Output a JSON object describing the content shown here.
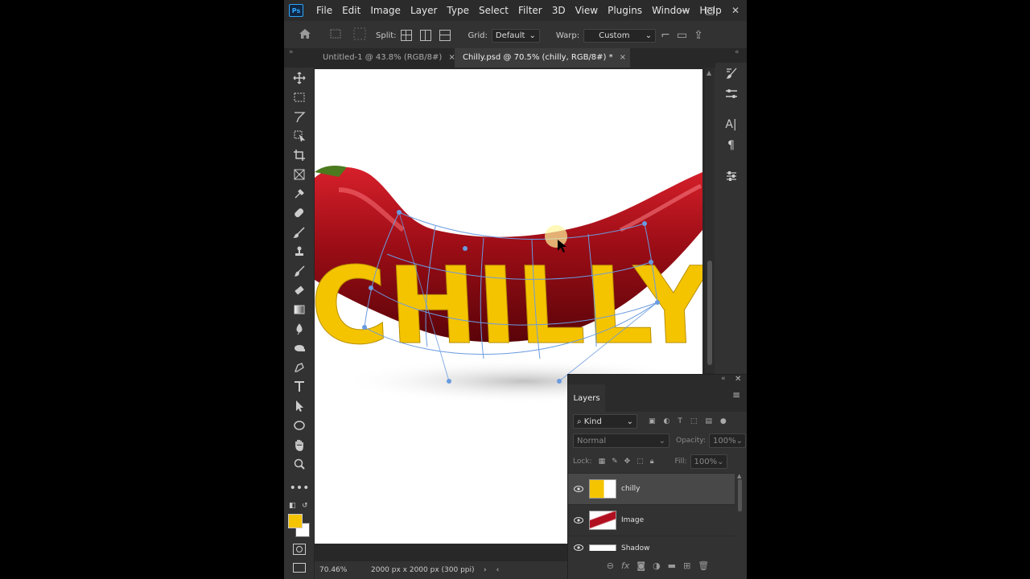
{
  "menu": [
    "File",
    "Edit",
    "Image",
    "Layer",
    "Type",
    "Select",
    "Filter",
    "3D",
    "View",
    "Plugins",
    "Window",
    "Help"
  ],
  "app_logo": "Ps",
  "options": {
    "split_label": "Split:",
    "grid_label": "Grid:",
    "grid_value": "Default",
    "warp_label": "Warp:",
    "warp_value": "Custom"
  },
  "tabs": [
    {
      "label": "Untitled-1 @ 43.8% (RGB/8#)",
      "close": "×"
    },
    {
      "label": "Chilly.psd @ 70.5% (chilly, RGB/8#) *",
      "close": "×"
    }
  ],
  "canvas_text": "CHILLY",
  "colors": {
    "foreground": "#f5c400",
    "background": "#ffffff",
    "accent": "#6a9be0"
  },
  "status": {
    "zoom": "70.46%",
    "doc_size": "2000 px x 2000 px (300 ppi)",
    "arrow": "›"
  },
  "layers_panel": {
    "title": "Layers",
    "kind_label": "Kind",
    "blend_mode": "Normal",
    "opacity_label": "Opacity:",
    "opacity_value": "100%",
    "lock_label": "Lock:",
    "fill_label": "Fill:",
    "fill_value": "100%",
    "layers": [
      {
        "name": "chilly",
        "selected": true
      },
      {
        "name": "Image",
        "selected": false
      },
      {
        "name": "Shadow",
        "selected": false
      }
    ]
  },
  "icons": {
    "tools": [
      "move-icon",
      "marquee-icon",
      "lasso-icon",
      "object-select-icon",
      "crop-icon",
      "frame-icon",
      "eyedropper-icon",
      "healing-icon",
      "brush-icon",
      "stamp-icon",
      "history-brush-icon",
      "eraser-icon",
      "gradient-icon",
      "blur-icon",
      "dodge-icon",
      "pen-icon",
      "type-icon",
      "path-select-icon",
      "ellipse-icon",
      "hand-icon",
      "zoom-icon",
      "more-icon"
    ]
  }
}
